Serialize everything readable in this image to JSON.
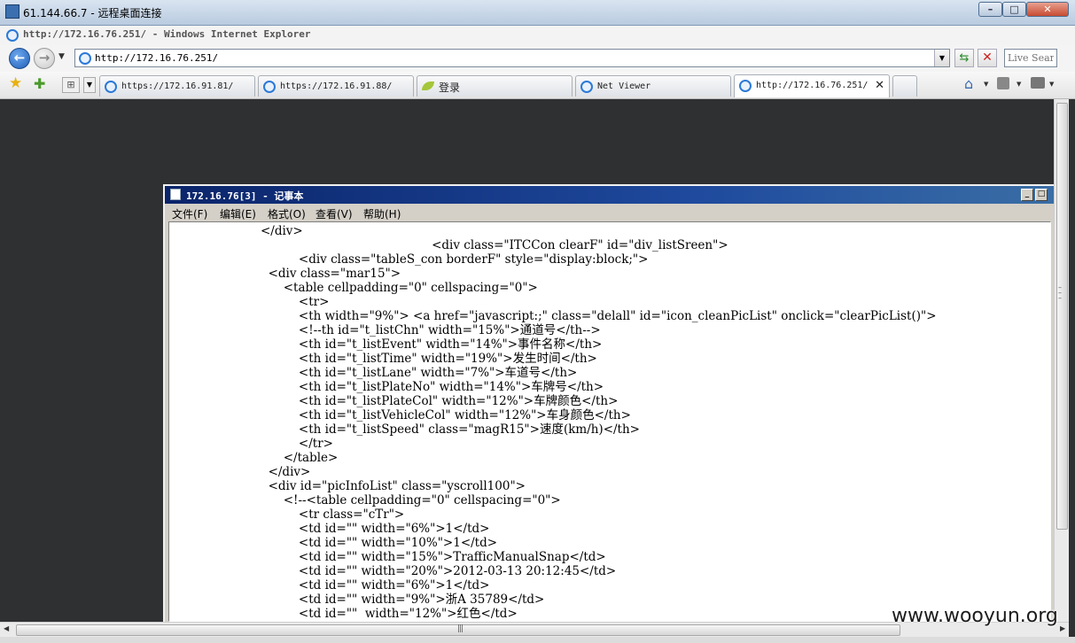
{
  "remote_desktop": {
    "title": "61.144.66.7 - 远程桌面连接",
    "min_glyph": "–",
    "max_glyph": "□",
    "close_glyph": "✕"
  },
  "browser": {
    "window_title": "http://172.16.76.251/ - Windows Internet Explorer",
    "address": "http://172.16.76.251/",
    "search_placeholder": "Live Search",
    "tabs": [
      {
        "label": "https://172.16.91.81/",
        "icon": "ie-icon"
      },
      {
        "label": "https://172.16.91.88/",
        "icon": "ie-icon"
      },
      {
        "label": "登录",
        "icon": "leaf-icon"
      },
      {
        "label": "Net Viewer",
        "icon": "ie-icon"
      },
      {
        "label": "http://172.16.76.251/",
        "icon": "ie-icon",
        "active": true
      }
    ],
    "tab_close_glyph": "✕"
  },
  "notepad": {
    "title": "172.16.76[3] - 记事本",
    "menu": [
      "文件(F)",
      "编辑(E)",
      "格式(O)",
      "查看(V)",
      "帮助(H)"
    ],
    "lines": [
      "                        </div>",
      "                                                                     <div class=\"ITCCon clearF\" id=\"div_listSreen\">",
      "                                  <div class=\"tableS_con borderF\" style=\"display:block;\">",
      "                          <div class=\"mar15\">",
      "                              <table cellpadding=\"0\" cellspacing=\"0\">",
      "                                  <tr>",
      "                                  <th width=\"9%\"> <a href=\"javascript:;\" class=\"delall\" id=\"icon_cleanPicList\" onclick=\"clearPicList()\">",
      "                                  <!--th id=\"t_listChn\" width=\"15%\">通道号</th-->",
      "                                  <th id=\"t_listEvent\" width=\"14%\">事件名称</th>",
      "                                  <th id=\"t_listTime\" width=\"19%\">发生时间</th>",
      "                                  <th id=\"t_listLane\" width=\"7%\">车道号</th>",
      "                                  <th id=\"t_listPlateNo\" width=\"14%\">车牌号</th>",
      "                                  <th id=\"t_listPlateCol\" width=\"12%\">车牌颜色</th>",
      "                                  <th id=\"t_listVehicleCol\" width=\"12%\">车身颜色</th>",
      "                                  <th id=\"t_listSpeed\" class=\"magR15\">速度(km/h)</th>",
      "                                  </tr>",
      "                              </table>",
      "                          </div>",
      "                          <div id=\"picInfoList\" class=\"yscroll100\">",
      "                              <!--<table cellpadding=\"0\" cellspacing=\"0\">",
      "                                  <tr class=\"cTr\">",
      "                                  <td id=\"\" width=\"6%\">1</td>",
      "                                  <td id=\"\" width=\"10%\">1</td>",
      "                                  <td id=\"\" width=\"15%\">TrafficManualSnap</td>",
      "                                  <td id=\"\" width=\"20%\">2012-03-13 20:12:45</td>",
      "                                  <td id=\"\" width=\"6%\">1</td>",
      "                                  <td id=\"\" width=\"9%\">浙A 35789</td>",
      "                                  <td id=\"\"  width=\"12%\">红色</td>"
    ]
  },
  "watermark": "www.wooyun.org"
}
